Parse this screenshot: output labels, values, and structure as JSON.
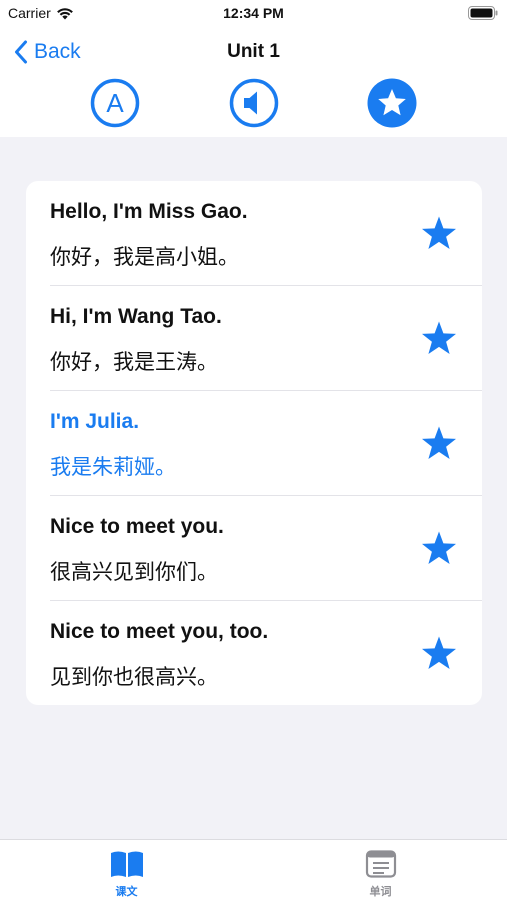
{
  "status_bar": {
    "carrier": "Carrier",
    "time": "12:34 PM"
  },
  "nav": {
    "back_label": "Back",
    "title": "Unit 1"
  },
  "toolbar": {
    "buttons": [
      {
        "icon": "letter-a-circle-icon",
        "letter": "A"
      },
      {
        "icon": "speaker-circle-icon"
      },
      {
        "icon": "star-circle-filled-icon"
      }
    ]
  },
  "sentences": [
    {
      "en": "Hello, I'm Miss Gao.",
      "zh": "你好，我是高小姐。",
      "active": false,
      "favorited": true
    },
    {
      "en": "Hi, I'm Wang Tao.",
      "zh": "你好，我是王涛。",
      "active": false,
      "favorited": true
    },
    {
      "en": "I'm Julia.",
      "zh": "我是朱莉娅。",
      "active": true,
      "favorited": true
    },
    {
      "en": "Nice to meet you.",
      "zh": "很高兴见到你们。",
      "active": false,
      "favorited": true
    },
    {
      "en": "Nice to meet you, too.",
      "zh": "见到你也很高兴。",
      "active": false,
      "favorited": true
    }
  ],
  "tab_bar": {
    "tabs": [
      {
        "label": "课文",
        "icon": "book-icon",
        "selected": true
      },
      {
        "label": "单词",
        "icon": "list-card-icon",
        "selected": false
      }
    ]
  },
  "colors": {
    "accent": "#1a7cf0",
    "text": "#111111",
    "background": "#f2f2f7",
    "inactive_tab": "#8e8e93"
  }
}
